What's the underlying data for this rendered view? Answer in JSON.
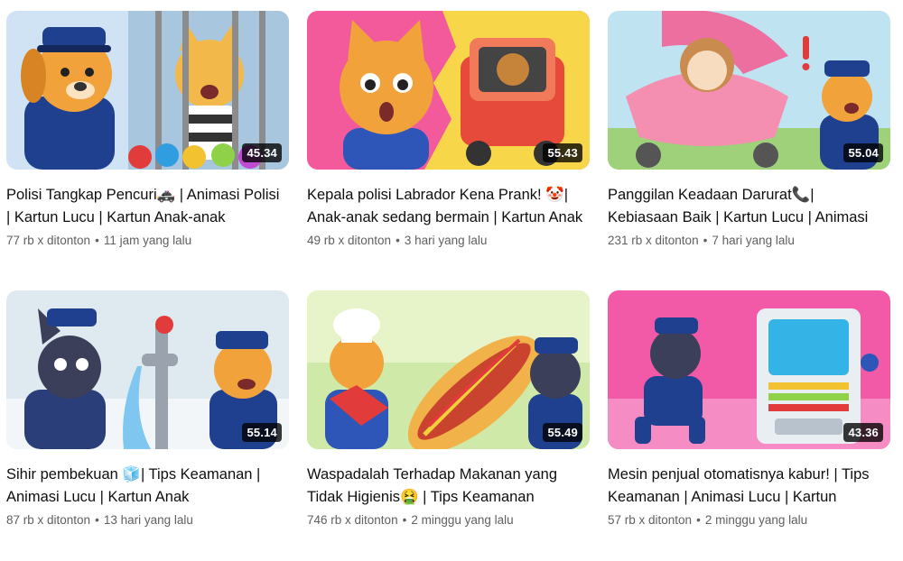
{
  "videos": [
    {
      "title": "Polisi Tangkap Pencuri🚓 | Animasi Polisi | Kartun Lucu | Kartun Anak-anak",
      "views": "77 rb x ditonton",
      "age": "11 jam yang lalu",
      "duration": "45.34",
      "thumb_icons": [
        "police-dog-icon",
        "jailed-cat-icon",
        "padlocks-icon"
      ]
    },
    {
      "title": "Kepala polisi Labrador Kena Prank! 🤡| Anak-anak sedang bermain | Kartun Anak",
      "views": "49 rb x ditonton",
      "age": "3 hari yang lalu",
      "duration": "55.43",
      "thumb_icons": [
        "surprised-dog-icon",
        "toy-car-icon"
      ]
    },
    {
      "title": "Panggilan Keadaan Darurat📞| Kebiasaan Baik | Kartun Lucu | Animasi",
      "views": "231 rb x ditonton",
      "age": "7 hari yang lalu",
      "duration": "55.04",
      "thumb_icons": [
        "baby-stroller-icon",
        "police-dog-icon"
      ]
    },
    {
      "title": "Sihir pembekuan 🧊| Tips Keamanan | Animasi Lucu | Kartun Anak",
      "views": "87 rb x ditonton",
      "age": "13 hari yang lalu",
      "duration": "55.14",
      "thumb_icons": [
        "frozen-dog-icon",
        "water-tap-icon"
      ]
    },
    {
      "title": "Waspadalah Terhadap Makanan yang Tidak Higienis🤮 | Tips Keamanan",
      "views": "746 rb x ditonton",
      "age": "2 minggu yang lalu",
      "duration": "55.49",
      "thumb_icons": [
        "chef-dog-icon",
        "hotdog-icon"
      ]
    },
    {
      "title": "Mesin penjual otomatisnya kabur! | Tips Keamanan | Animasi Lucu | Kartun",
      "views": "57 rb x ditonton",
      "age": "2 minggu yang lalu",
      "duration": "43.36",
      "thumb_icons": [
        "vending-machine-icon",
        "running-dog-icon"
      ]
    }
  ],
  "colors": {
    "title_text": "#0f0f0f",
    "meta_text": "#606060",
    "duration_bg": "#000000",
    "police_blue": "#1f3f8f",
    "dog_orange": "#f2a23a"
  }
}
